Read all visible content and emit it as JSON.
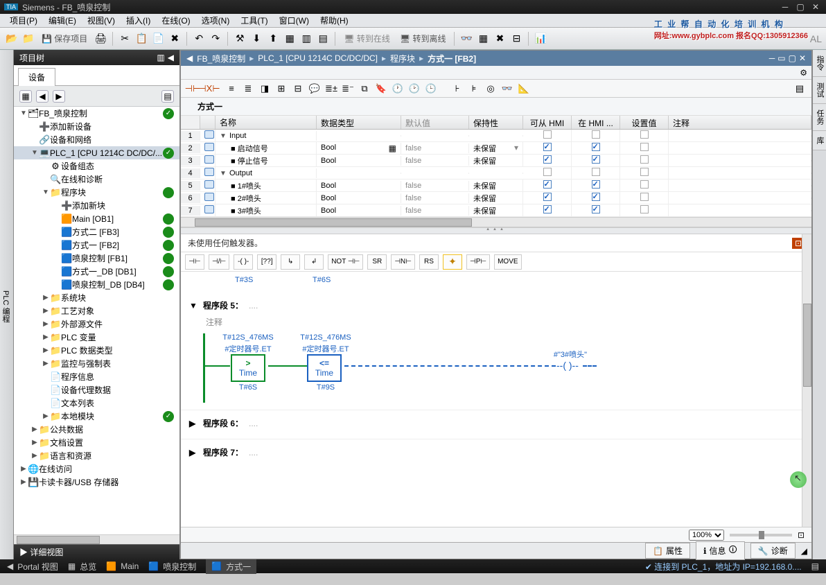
{
  "title": "Siemens - FB_喷泉控制",
  "menus": [
    "项目(P)",
    "编辑(E)",
    "视图(V)",
    "插入(I)",
    "在线(O)",
    "选项(N)",
    "工具(T)",
    "窗口(W)",
    "帮助(H)"
  ],
  "watermark": {
    "main": "工 业 帮 自 动 化 培 训 机 构",
    "sub": "网址:www.gybplc.com    报名QQ:1305912366"
  },
  "toolbar": {
    "save": "保存项目",
    "online": "转到在线",
    "offline": "转到离线",
    "tail": "AL"
  },
  "sidebar": {
    "title": "项目树",
    "devtab": "设备",
    "tree": [
      {
        "l": 0,
        "ar": "▼",
        "ic": "🗂",
        "t": "FB_喷泉控制",
        "st": "chk"
      },
      {
        "l": 1,
        "ar": "",
        "ic": "➕",
        "t": "添加新设备"
      },
      {
        "l": 1,
        "ar": "",
        "ic": "🔗",
        "t": "设备和网络"
      },
      {
        "l": 1,
        "ar": "▼",
        "ic": "💻",
        "t": "PLC_1 [CPU 1214C DC/DC/...",
        "sel": true,
        "st": "chk"
      },
      {
        "l": 2,
        "ar": "",
        "ic": "⚙",
        "t": "设备组态"
      },
      {
        "l": 2,
        "ar": "",
        "ic": "🔍",
        "t": "在线和诊断"
      },
      {
        "l": 2,
        "ar": "▼",
        "ic": "📁",
        "t": "程序块",
        "st": "dot"
      },
      {
        "l": 3,
        "ar": "",
        "ic": "➕",
        "t": "添加新块"
      },
      {
        "l": 3,
        "ar": "",
        "ic": "🟧",
        "t": "Main [OB1]",
        "st": "dot"
      },
      {
        "l": 3,
        "ar": "",
        "ic": "🟦",
        "t": "方式二 [FB3]",
        "st": "dot"
      },
      {
        "l": 3,
        "ar": "",
        "ic": "🟦",
        "t": "方式一 [FB2]",
        "st": "dot"
      },
      {
        "l": 3,
        "ar": "",
        "ic": "🟦",
        "t": "喷泉控制 [FB1]",
        "st": "dot"
      },
      {
        "l": 3,
        "ar": "",
        "ic": "🟦",
        "t": "方式一_DB [DB1]",
        "st": "dot"
      },
      {
        "l": 3,
        "ar": "",
        "ic": "🟦",
        "t": "喷泉控制_DB [DB4]",
        "st": "dot"
      },
      {
        "l": 2,
        "ar": "▶",
        "ic": "📁",
        "t": "系统块"
      },
      {
        "l": 2,
        "ar": "▶",
        "ic": "📁",
        "t": "工艺对象"
      },
      {
        "l": 2,
        "ar": "▶",
        "ic": "📁",
        "t": "外部源文件"
      },
      {
        "l": 2,
        "ar": "▶",
        "ic": "📁",
        "t": "PLC 变量"
      },
      {
        "l": 2,
        "ar": "▶",
        "ic": "📁",
        "t": "PLC 数据类型"
      },
      {
        "l": 2,
        "ar": "▶",
        "ic": "📁",
        "t": "监控与强制表"
      },
      {
        "l": 2,
        "ar": "",
        "ic": "📄",
        "t": "程序信息"
      },
      {
        "l": 2,
        "ar": "",
        "ic": "📄",
        "t": "设备代理数据"
      },
      {
        "l": 2,
        "ar": "",
        "ic": "📄",
        "t": "文本列表"
      },
      {
        "l": 2,
        "ar": "▶",
        "ic": "📁",
        "t": "本地模块",
        "st": "chk"
      },
      {
        "l": 1,
        "ar": "▶",
        "ic": "📁",
        "t": "公共数据"
      },
      {
        "l": 1,
        "ar": "▶",
        "ic": "📁",
        "t": "文档设置"
      },
      {
        "l": 1,
        "ar": "▶",
        "ic": "📁",
        "t": "语言和资源"
      },
      {
        "l": 0,
        "ar": "▶",
        "ic": "🌐",
        "t": "在线访问"
      },
      {
        "l": 0,
        "ar": "▶",
        "ic": "💾",
        "t": "卡读卡器/USB 存储器"
      }
    ],
    "detail": "详细视图"
  },
  "breadcrumb": [
    "FB_喷泉控制",
    "PLC_1 [CPU 1214C DC/DC/DC]",
    "程序块",
    "方式一 [FB2]"
  ],
  "blockname": "方式一",
  "vartable": {
    "headers": [
      "",
      "名称",
      "数据类型",
      "默认值",
      "保持性",
      "可从 HMI ...",
      "在 HMI ...",
      "设置值",
      "注释"
    ],
    "rows": [
      {
        "n": 1,
        "kind": "hdr",
        "arrow": "▼",
        "name": "Input"
      },
      {
        "n": 2,
        "kind": "var",
        "name": "启动信号",
        "type": "Bool",
        "def": "false",
        "keep": "未保留",
        "hmi1": true,
        "hmi2": true,
        "edit": true
      },
      {
        "n": 3,
        "kind": "var",
        "name": "停止信号",
        "type": "Bool",
        "def": "false",
        "keep": "未保留",
        "hmi1": true,
        "hmi2": true
      },
      {
        "n": 4,
        "kind": "hdr",
        "arrow": "▼",
        "name": "Output"
      },
      {
        "n": 5,
        "kind": "var",
        "name": "1#喷头",
        "type": "Bool",
        "def": "false",
        "keep": "未保留",
        "hmi1": true,
        "hmi2": true
      },
      {
        "n": 6,
        "kind": "var",
        "name": "2#喷头",
        "type": "Bool",
        "def": "false",
        "keep": "未保留",
        "hmi1": true,
        "hmi2": true
      },
      {
        "n": 7,
        "kind": "var",
        "name": "3#喷头",
        "type": "Bool",
        "def": "false",
        "keep": "未保留",
        "hmi1": true,
        "hmi2": true
      }
    ]
  },
  "trigger": "未使用任何触发器。",
  "instructions": [
    "⊣⊢",
    "⊣/⊢",
    "-( )-",
    "[??]",
    "↳",
    "↲",
    "NOT\n⊣⊢",
    "SR",
    "⊣N⊢",
    "RS",
    "✦",
    "⊣P⊢",
    "MOVE"
  ],
  "times_above": {
    "a": "T#3S",
    "b": "T#6S"
  },
  "network5": {
    "title": "程序段 5：",
    "comment": "注释",
    "block1": {
      "top": "T#12S_476MS",
      "top2": "#定时器号.ET",
      "op": ">",
      "type": "Time",
      "bot": "T#6S"
    },
    "block2": {
      "top": "T#12S_476MS",
      "top2": "#定时器号.ET",
      "op": "<=",
      "type": "Time",
      "bot": "T#9S"
    },
    "coil": "#\"3#喷头\""
  },
  "network6": "程序段 6：",
  "network7": "程序段 7：",
  "zoom": "100%",
  "bottomtabs": {
    "props": "属性",
    "info": "信息",
    "diag": "诊断"
  },
  "status": {
    "portal": "Portal 视图",
    "overview": "总览",
    "t1": "Main",
    "t2": "喷泉控制",
    "t3": "方式一",
    "conn": "连接到 PLC_1，地址为 IP=192.168.0...."
  },
  "righttabs": [
    "指令",
    "测试",
    "任务",
    "库"
  ]
}
